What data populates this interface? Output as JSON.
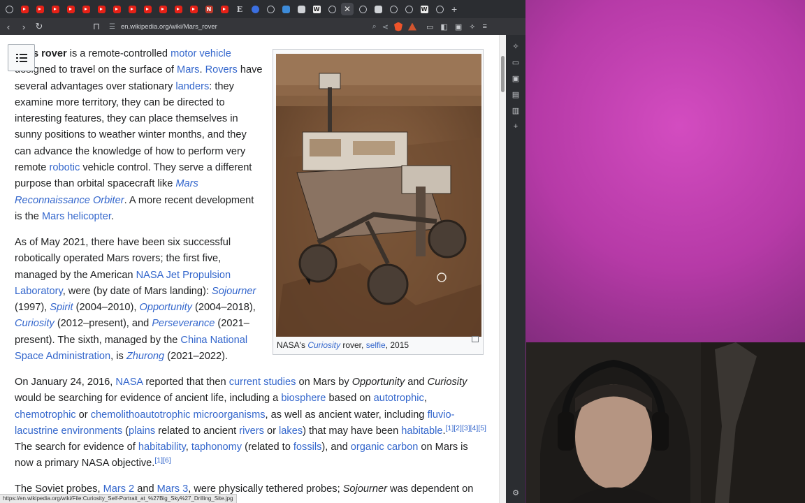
{
  "browser": {
    "tabs": [
      {
        "icon": "globe-icon"
      },
      {
        "icon": "youtube-icon"
      },
      {
        "icon": "youtube-icon"
      },
      {
        "icon": "youtube-icon"
      },
      {
        "icon": "youtube-icon"
      },
      {
        "icon": "youtube-icon"
      },
      {
        "icon": "youtube-icon"
      },
      {
        "icon": "youtube-icon"
      },
      {
        "icon": "youtube-icon"
      },
      {
        "icon": "youtube-icon"
      },
      {
        "icon": "youtube-icon"
      },
      {
        "icon": "youtube-icon"
      },
      {
        "icon": "youtube-icon"
      },
      {
        "icon": "netflix-icon",
        "letter": "N"
      },
      {
        "icon": "youtube-icon"
      },
      {
        "icon": "epub-icon",
        "letter": "E"
      },
      {
        "icon": "blue-circle-icon"
      },
      {
        "icon": "globe-icon"
      },
      {
        "icon": "grid-icon"
      },
      {
        "icon": "image-icon"
      },
      {
        "icon": "wikipedia-icon",
        "letter": "W"
      },
      {
        "icon": "globe-icon"
      },
      {
        "icon": "close-icon",
        "active": true
      },
      {
        "icon": "globe-icon"
      },
      {
        "icon": "image-icon"
      },
      {
        "icon": "globe-icon"
      },
      {
        "icon": "globe-icon"
      },
      {
        "icon": "wikipedia-icon",
        "letter": "W"
      },
      {
        "icon": "sync-icon"
      }
    ],
    "new_tab_symbol": "+",
    "url": "en.wikipedia.org/wiki/Mars_rover",
    "status_url": "https://en.wikipedia.org/wiki/File:Curiosity_Self-Portrait_at_%27Big_Sky%27_Drilling_Site.jpg"
  },
  "article": {
    "p1": [
      {
        "t": "Mars rover",
        "b": true
      },
      {
        "t": " is a remote-controlled "
      },
      {
        "t": "motor vehicle",
        "link": true
      },
      {
        "t": " designed to travel on the surface of "
      },
      {
        "t": "Mars",
        "link": true
      },
      {
        "t": ". "
      },
      {
        "t": "Rovers",
        "link": true
      },
      {
        "t": " have several advantages over stationary "
      },
      {
        "t": "landers",
        "link": true
      },
      {
        "t": ": they examine more territory, they can be directed to interesting features, they can place themselves in sunny positions to weather winter months, and they can advance the knowledge of how to perform very remote "
      },
      {
        "t": "robotic",
        "link": true
      },
      {
        "t": " vehicle control. They serve a different purpose than orbital spacecraft like "
      },
      {
        "t": "Mars Reconnaissance Orbiter",
        "link": true,
        "i": true
      },
      {
        "t": ". A more recent development is the "
      },
      {
        "t": "Mars helicopter",
        "link": true
      },
      {
        "t": "."
      }
    ],
    "p2": [
      {
        "t": "As of May 2021, there have been six successful robotically operated Mars rovers; the first five, managed by the American "
      },
      {
        "t": "NASA Jet Propulsion Laboratory",
        "link": true
      },
      {
        "t": ", were (by date of Mars landing): "
      },
      {
        "t": "Sojourner",
        "link": true,
        "i": true
      },
      {
        "t": " (1997), "
      },
      {
        "t": "Spirit",
        "link": true,
        "i": true
      },
      {
        "t": " (2004–2010), "
      },
      {
        "t": "Opportunity",
        "link": true,
        "i": true
      },
      {
        "t": " (2004–2018), "
      },
      {
        "t": "Curiosity",
        "link": true,
        "i": true
      },
      {
        "t": " (2012–present), and "
      },
      {
        "t": "Perseverance",
        "link": true,
        "i": true
      },
      {
        "t": " (2021–present). The sixth, managed by the "
      },
      {
        "t": "China National Space Administration",
        "link": true
      },
      {
        "t": ", is "
      },
      {
        "t": "Zhurong",
        "link": true,
        "i": true
      },
      {
        "t": " (2021–2022)."
      }
    ],
    "p3": [
      {
        "t": "On January 24, 2016, "
      },
      {
        "t": "NASA",
        "link": true
      },
      {
        "t": " reported that then "
      },
      {
        "t": "current studies",
        "link": true
      },
      {
        "t": " on Mars by "
      },
      {
        "t": "Opportunity",
        "i": true
      },
      {
        "t": " and "
      },
      {
        "t": "Curiosity",
        "i": true
      },
      {
        "t": " would be searching for evidence of ancient life, including a "
      },
      {
        "t": "biosphere",
        "link": true
      },
      {
        "t": " based on "
      },
      {
        "t": "autotrophic",
        "link": true
      },
      {
        "t": ", "
      },
      {
        "t": "chemotrophic",
        "link": true
      },
      {
        "t": " or "
      },
      {
        "t": "chemolithoautotrophic",
        "link": true
      },
      {
        "t": " "
      },
      {
        "t": "microorganisms",
        "link": true
      },
      {
        "t": ", as well as ancient water, including "
      },
      {
        "t": "fluvio-lacustrine environments",
        "link": true
      },
      {
        "t": " ("
      },
      {
        "t": "plains",
        "link": true
      },
      {
        "t": " related to ancient "
      },
      {
        "t": "rivers",
        "link": true
      },
      {
        "t": " or "
      },
      {
        "t": "lakes",
        "link": true
      },
      {
        "t": ") that may have been "
      },
      {
        "t": "habitable",
        "link": true
      },
      {
        "t": "."
      },
      {
        "t": "[1][2][3][4][5]",
        "link": true,
        "sup": true
      },
      {
        "t": " The search for evidence of "
      },
      {
        "t": "habitability",
        "link": true
      },
      {
        "t": ", "
      },
      {
        "t": "taphonomy",
        "link": true
      },
      {
        "t": " (related to "
      },
      {
        "t": "fossils",
        "link": true
      },
      {
        "t": "), and "
      },
      {
        "t": "organic carbon",
        "link": true
      },
      {
        "t": " on Mars is now a primary NASA objective."
      },
      {
        "t": "[1][6]",
        "link": true,
        "sup": true
      }
    ],
    "p4": [
      {
        "t": "The Soviet probes, "
      },
      {
        "t": "Mars 2",
        "link": true
      },
      {
        "t": " and "
      },
      {
        "t": "Mars 3",
        "link": true
      },
      {
        "t": ", were physically tethered probes; "
      },
      {
        "t": "Sojourner",
        "i": true
      },
      {
        "t": " was dependent on the"
      }
    ]
  },
  "figure": {
    "caption_prefix": "NASA's ",
    "caption_link": "Curiosity",
    "caption_mid": " rover, ",
    "caption_link2": "selfie",
    "caption_suffix": ", 2015"
  },
  "sidepanel_icons": [
    "bookmark-icon",
    "history-icon",
    "wallet-icon",
    "downloads-icon",
    "reading-list-icon",
    "add-icon",
    "settings-icon"
  ]
}
